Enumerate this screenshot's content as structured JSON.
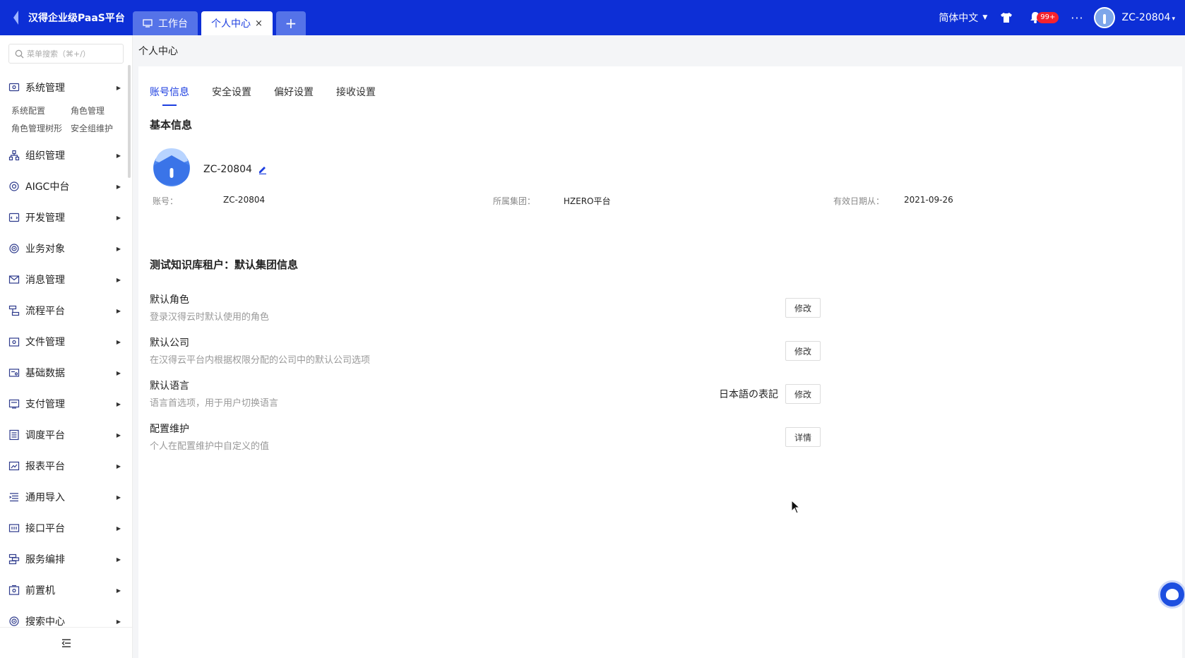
{
  "header": {
    "brand": "汉得企业级PaaS平台",
    "tabs": [
      {
        "label": "工作台"
      },
      {
        "label": "个人中心",
        "close": "×"
      }
    ],
    "add_tab": "+",
    "language": "简体中文",
    "notifications_badge": "99+",
    "more": "···",
    "user": "ZC-20804"
  },
  "sidebar": {
    "search_placeholder": "菜单搜索（⌘+/）",
    "items": [
      {
        "label": "系统管理",
        "icon": "system-icon"
      },
      {
        "label": "组织管理",
        "icon": "org-icon"
      },
      {
        "label": "AIGC中台",
        "icon": "aigc-icon"
      },
      {
        "label": "开发管理",
        "icon": "dev-icon"
      },
      {
        "label": "业务对象",
        "icon": "object-icon"
      },
      {
        "label": "消息管理",
        "icon": "message-icon"
      },
      {
        "label": "流程平台",
        "icon": "workflow-icon"
      },
      {
        "label": "文件管理",
        "icon": "file-icon"
      },
      {
        "label": "基础数据",
        "icon": "data-icon"
      },
      {
        "label": "支付管理",
        "icon": "payment-icon"
      },
      {
        "label": "调度平台",
        "icon": "schedule-icon"
      },
      {
        "label": "报表平台",
        "icon": "report-icon"
      },
      {
        "label": "通用导入",
        "icon": "import-icon"
      },
      {
        "label": "接口平台",
        "icon": "api-icon"
      },
      {
        "label": "服务编排",
        "icon": "orchestration-icon"
      },
      {
        "label": "前置机",
        "icon": "frontend-icon"
      },
      {
        "label": "搜索中心",
        "icon": "search-center-icon"
      }
    ],
    "submenu": [
      "系统配置",
      "角色管理",
      "角色管理树形",
      "安全组维护"
    ]
  },
  "breadcrumb": "个人中心",
  "content_tabs": [
    {
      "label": "账号信息",
      "active": true
    },
    {
      "label": "安全设置",
      "active": false
    },
    {
      "label": "偏好设置",
      "active": false
    },
    {
      "label": "接收设置",
      "active": false
    }
  ],
  "basic_info": {
    "title": "基本信息",
    "name": "ZC-20804",
    "fields": [
      {
        "label": "账号：",
        "value": "ZC-20804"
      },
      {
        "label": "所属集团：",
        "value": "HZERO平台"
      },
      {
        "label": "有效日期从：",
        "value": "2021-09-26"
      }
    ]
  },
  "group_info": {
    "title": "测试知识库租户：默认集团信息",
    "settings": [
      {
        "title": "默认角色",
        "desc": "登录汉得云时默认使用的角色",
        "value": "",
        "button": "修改"
      },
      {
        "title": "默认公司",
        "desc": "在汉得云平台内根据权限分配的公司中的默认公司选项",
        "value": "",
        "button": "修改"
      },
      {
        "title": "默认语言",
        "desc": "语言首选项，用于用户切换语言",
        "value": "日本語の表記",
        "button": "修改"
      },
      {
        "title": "配置维护",
        "desc": "个人在配置维护中自定义的值",
        "value": "",
        "button": "详情"
      }
    ]
  },
  "colors": {
    "primary": "#0d2fd6",
    "accent": "#1c3ee0",
    "badge": "#f5222d"
  }
}
